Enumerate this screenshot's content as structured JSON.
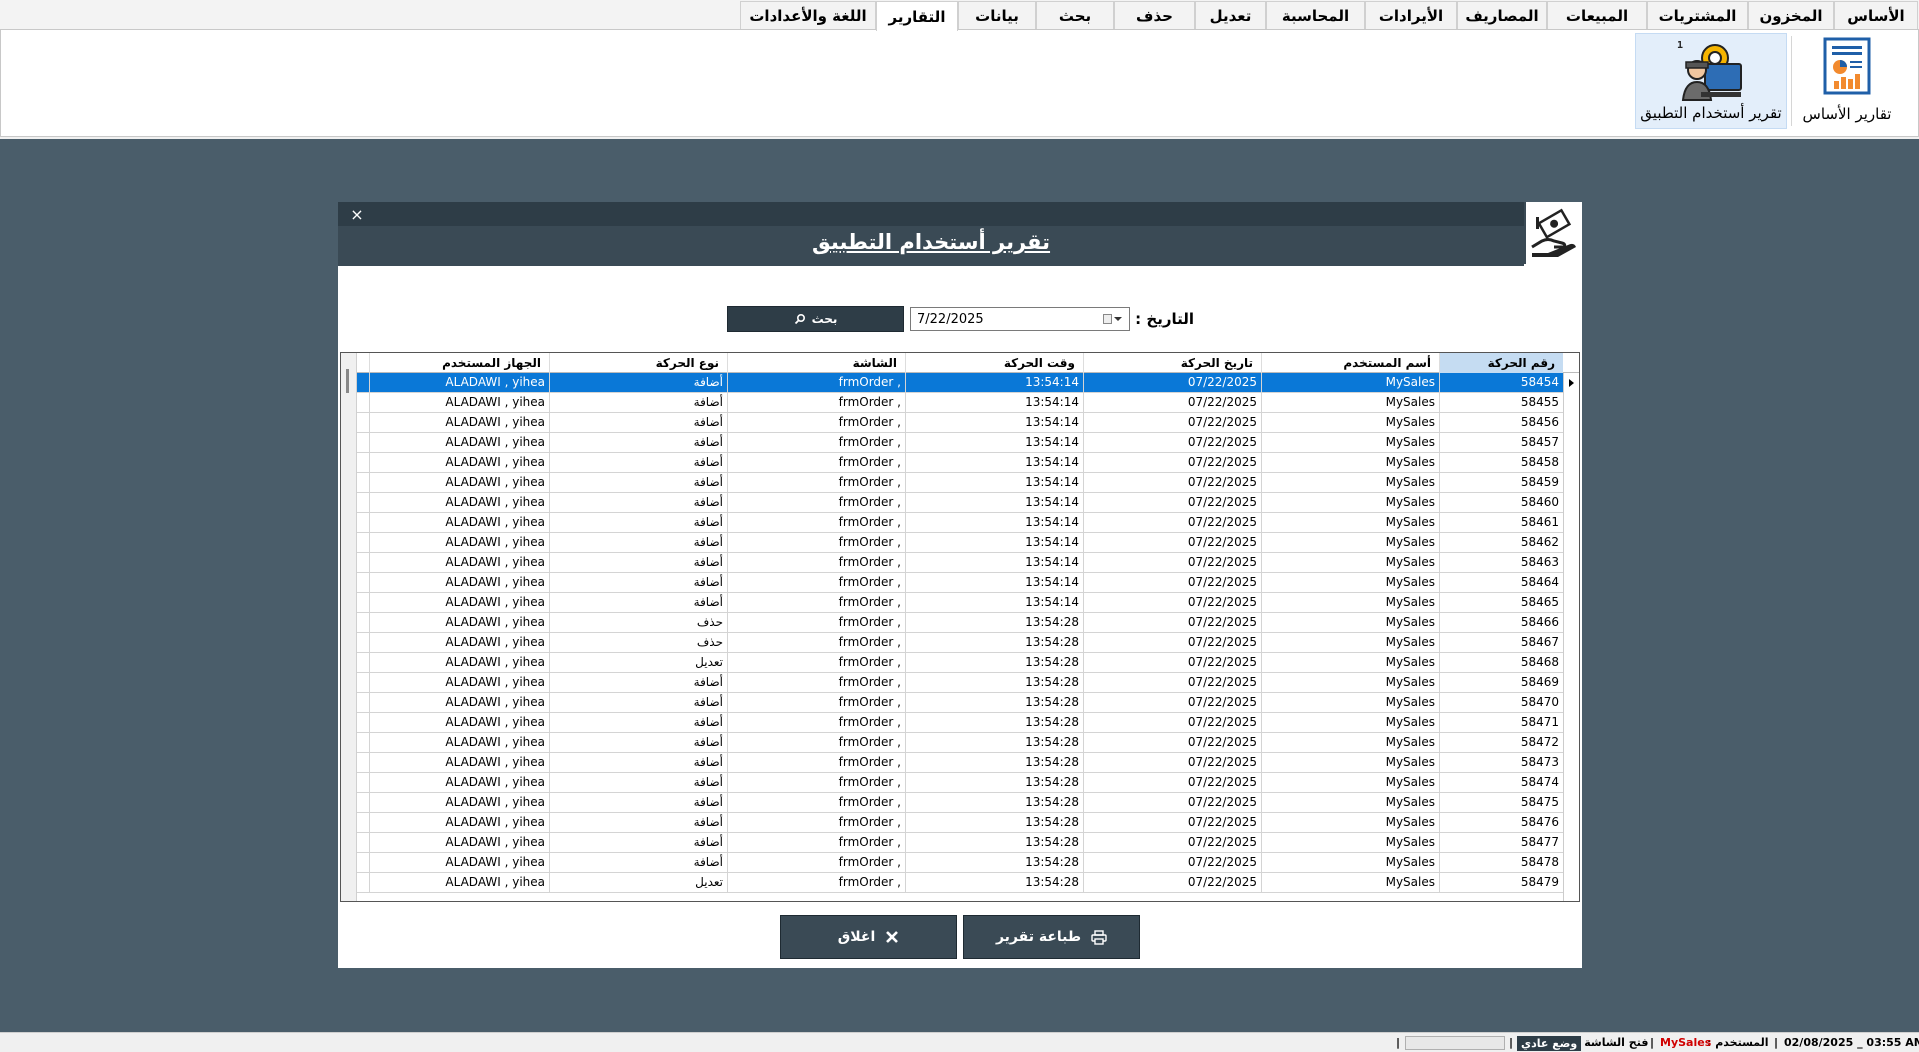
{
  "ribbon": {
    "tabs": [
      "الأساس",
      "المخزون",
      "المشتريات",
      "المبيعات",
      "المصاريف",
      "الأيرادات",
      "المحاسبة",
      "تعديل",
      "حذف",
      "بحث",
      "بيانات",
      "التقارير",
      "اللغة والأعدادات"
    ],
    "active_tab": "التقارير",
    "buttons": [
      {
        "label": "تقارير الأساس",
        "icon": "report-chart-icon"
      },
      {
        "label": "تقرير أستخدام التطبيق",
        "icon": "developer-usage-icon"
      }
    ]
  },
  "dialog": {
    "title": "تقرير أستخدام التطبيق",
    "close_glyph": "×",
    "date_label": "التاريخ :",
    "date_value": "7/22/2025",
    "search_label": "بحث",
    "print_label": "طباعة تقرير",
    "close_label": "اغلاق"
  },
  "grid": {
    "columns": [
      "رقم الحركة",
      "أسم المستخدم",
      "تاريخ الحركة",
      "وقت الحركة",
      "الشاشة",
      "نوع الحركة",
      "الجهاز المستخدم"
    ],
    "sorted_column": 0,
    "selected_row": 0,
    "rows": [
      [
        "58454",
        "MySales",
        "07/22/2025",
        "13:54:14",
        "frmOrder ,",
        "أضافة",
        "ALADAWI , yihea"
      ],
      [
        "58455",
        "MySales",
        "07/22/2025",
        "13:54:14",
        "frmOrder ,",
        "أضافة",
        "ALADAWI , yihea"
      ],
      [
        "58456",
        "MySales",
        "07/22/2025",
        "13:54:14",
        "frmOrder ,",
        "أضافة",
        "ALADAWI , yihea"
      ],
      [
        "58457",
        "MySales",
        "07/22/2025",
        "13:54:14",
        "frmOrder ,",
        "أضافة",
        "ALADAWI , yihea"
      ],
      [
        "58458",
        "MySales",
        "07/22/2025",
        "13:54:14",
        "frmOrder ,",
        "أضافة",
        "ALADAWI , yihea"
      ],
      [
        "58459",
        "MySales",
        "07/22/2025",
        "13:54:14",
        "frmOrder ,",
        "أضافة",
        "ALADAWI , yihea"
      ],
      [
        "58460",
        "MySales",
        "07/22/2025",
        "13:54:14",
        "frmOrder ,",
        "أضافة",
        "ALADAWI , yihea"
      ],
      [
        "58461",
        "MySales",
        "07/22/2025",
        "13:54:14",
        "frmOrder ,",
        "أضافة",
        "ALADAWI , yihea"
      ],
      [
        "58462",
        "MySales",
        "07/22/2025",
        "13:54:14",
        "frmOrder ,",
        "أضافة",
        "ALADAWI , yihea"
      ],
      [
        "58463",
        "MySales",
        "07/22/2025",
        "13:54:14",
        "frmOrder ,",
        "أضافة",
        "ALADAWI , yihea"
      ],
      [
        "58464",
        "MySales",
        "07/22/2025",
        "13:54:14",
        "frmOrder ,",
        "أضافة",
        "ALADAWI , yihea"
      ],
      [
        "58465",
        "MySales",
        "07/22/2025",
        "13:54:14",
        "frmOrder ,",
        "أضافة",
        "ALADAWI , yihea"
      ],
      [
        "58466",
        "MySales",
        "07/22/2025",
        "13:54:28",
        "frmOrder ,",
        "حذف",
        "ALADAWI , yihea"
      ],
      [
        "58467",
        "MySales",
        "07/22/2025",
        "13:54:28",
        "frmOrder ,",
        "حذف",
        "ALADAWI , yihea"
      ],
      [
        "58468",
        "MySales",
        "07/22/2025",
        "13:54:28",
        "frmOrder ,",
        "تعديل",
        "ALADAWI , yihea"
      ],
      [
        "58469",
        "MySales",
        "07/22/2025",
        "13:54:28",
        "frmOrder ,",
        "أضافة",
        "ALADAWI , yihea"
      ],
      [
        "58470",
        "MySales",
        "07/22/2025",
        "13:54:28",
        "frmOrder ,",
        "أضافة",
        "ALADAWI , yihea"
      ],
      [
        "58471",
        "MySales",
        "07/22/2025",
        "13:54:28",
        "frmOrder ,",
        "أضافة",
        "ALADAWI , yihea"
      ],
      [
        "58472",
        "MySales",
        "07/22/2025",
        "13:54:28",
        "frmOrder ,",
        "أضافة",
        "ALADAWI , yihea"
      ],
      [
        "58473",
        "MySales",
        "07/22/2025",
        "13:54:28",
        "frmOrder ,",
        "أضافة",
        "ALADAWI , yihea"
      ],
      [
        "58474",
        "MySales",
        "07/22/2025",
        "13:54:28",
        "frmOrder ,",
        "أضافة",
        "ALADAWI , yihea"
      ],
      [
        "58475",
        "MySales",
        "07/22/2025",
        "13:54:28",
        "frmOrder ,",
        "أضافة",
        "ALADAWI , yihea"
      ],
      [
        "58476",
        "MySales",
        "07/22/2025",
        "13:54:28",
        "frmOrder ,",
        "أضافة",
        "ALADAWI , yihea"
      ],
      [
        "58477",
        "MySales",
        "07/22/2025",
        "13:54:28",
        "frmOrder ,",
        "أضافة",
        "ALADAWI , yihea"
      ],
      [
        "58478",
        "MySales",
        "07/22/2025",
        "13:54:28",
        "frmOrder ,",
        "أضافة",
        "ALADAWI , yihea"
      ],
      [
        "58479",
        "MySales",
        "07/22/2025",
        "13:54:28",
        "frmOrder ,",
        "تعديل",
        "ALADAWI , yihea"
      ]
    ]
  },
  "status_bar": {
    "datetime": "02/08/2025 _ 03:55 AM",
    "sep": "|",
    "user_label": "المستخدم :",
    "user_value": "MySales",
    "screen_label": "فتح الشاشة :",
    "mode_badge": "وضع عادي"
  },
  "colors": {
    "workspace": "#4a5d6a",
    "dialog_header": "#3a4a55",
    "button": "#3a4a55",
    "selection": "#0a78d7",
    "user_red": "#d00000"
  }
}
